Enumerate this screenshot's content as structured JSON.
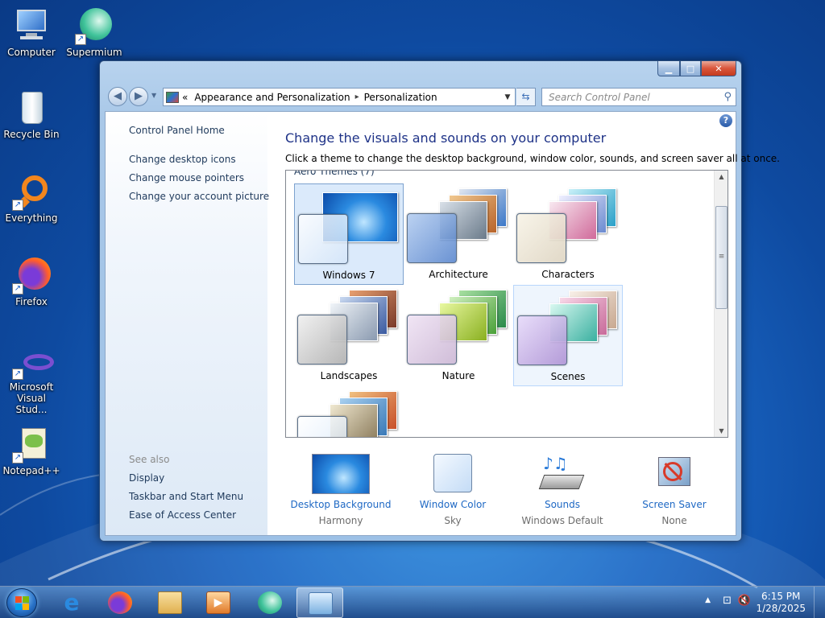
{
  "desktop": {
    "icons": [
      {
        "label": "Computer",
        "icon": "computer-icon"
      },
      {
        "label": "Supermium",
        "icon": "supermium-icon"
      },
      {
        "label": "Recycle Bin",
        "icon": "recycle-bin-icon"
      },
      {
        "label": "Everything",
        "icon": "everything-icon"
      },
      {
        "label": "Firefox",
        "icon": "firefox-icon"
      },
      {
        "label": "Microsoft Visual Stud...",
        "icon": "visual-studio-icon"
      },
      {
        "label": "Notepad++",
        "icon": "notepad-plus-plus-icon"
      }
    ]
  },
  "window": {
    "breadcrumb": {
      "chevrons": "«",
      "items": [
        "Appearance and Personalization",
        "Personalization"
      ],
      "separator": "▸"
    },
    "search_placeholder": "Search Control Panel",
    "sidebar": {
      "home": "Control Panel Home",
      "links": [
        "Change desktop icons",
        "Change mouse pointers",
        "Change your account picture"
      ],
      "see_also_heading": "See also",
      "see_also": [
        "Display",
        "Taskbar and Start Menu",
        "Ease of Access Center"
      ]
    },
    "main": {
      "title": "Change the visuals and sounds on your computer",
      "description": "Click a theme to change the desktop background, window color, sounds, and screen saver all at once.",
      "group_label": "Aero Themes (7)",
      "themes": [
        {
          "name": "Windows 7"
        },
        {
          "name": "Architecture"
        },
        {
          "name": "Characters"
        },
        {
          "name": "Landscapes"
        },
        {
          "name": "Nature"
        },
        {
          "name": "Scenes"
        },
        {
          "name": ""
        }
      ],
      "selected_theme": "Windows 7"
    },
    "bottom": [
      {
        "label": "Desktop Background",
        "value": "Harmony"
      },
      {
        "label": "Window Color",
        "value": "Sky"
      },
      {
        "label": "Sounds",
        "value": "Windows Default"
      },
      {
        "label": "Screen Saver",
        "value": "None"
      }
    ]
  },
  "taskbar": {
    "apps": [
      "internet-explorer-icon",
      "firefox-icon",
      "file-explorer-icon",
      "media-player-icon",
      "supermium-icon",
      "control-panel-icon"
    ],
    "time": "6:15 PM",
    "date": "1/28/2025"
  },
  "colors": {
    "link": "#1e68c4",
    "title": "#1e3287",
    "selection": "#dbeafb"
  }
}
